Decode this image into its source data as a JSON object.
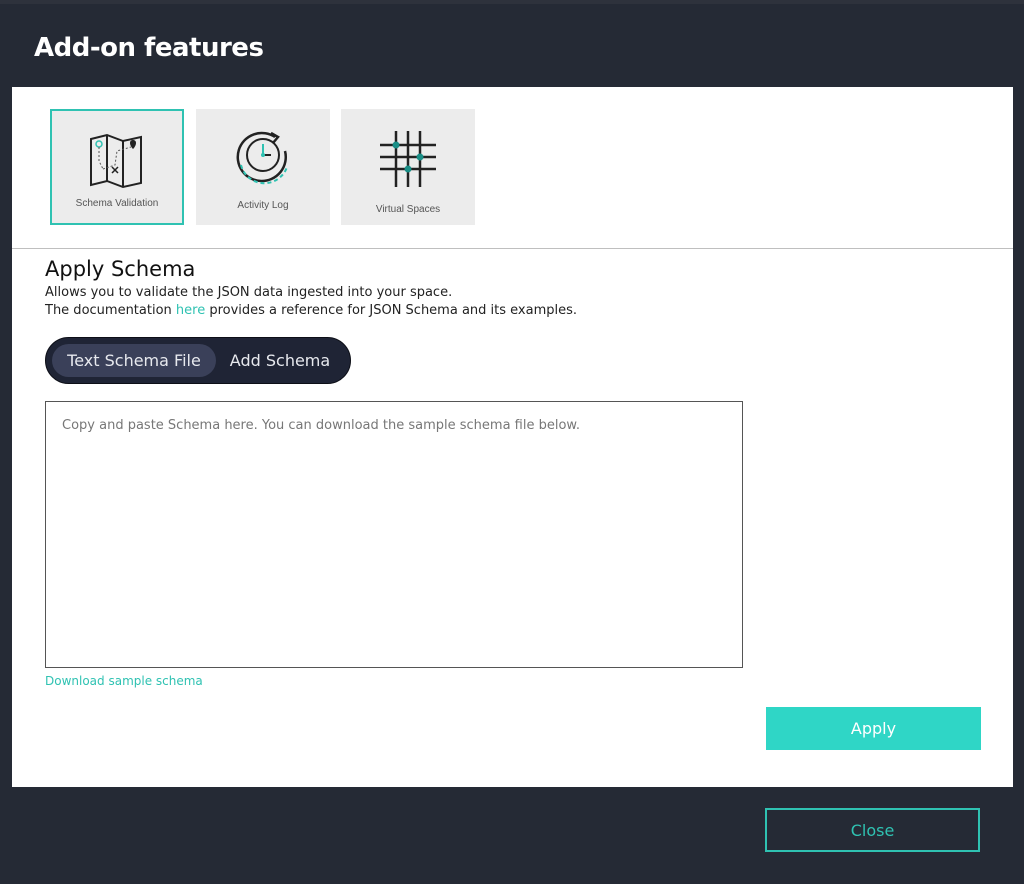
{
  "dialog": {
    "title": "Add-on features"
  },
  "tiles": [
    {
      "label": "Schema Validation",
      "icon": "map-icon",
      "selected": true
    },
    {
      "label": "Activity Log",
      "icon": "clock-icon",
      "selected": false
    },
    {
      "label": "Virtual Spaces",
      "icon": "grid-icon",
      "selected": false
    }
  ],
  "section": {
    "title": "Apply Schema",
    "line1": "Allows you to validate the JSON data ingested into your space.",
    "line2_before": "The documentation ",
    "line2_link": "here",
    "line2_after": " provides a reference for JSON Schema and its examples."
  },
  "toggle": {
    "option1": "Text Schema File",
    "option2": "Add Schema",
    "active": "Text Schema File"
  },
  "schema_input": {
    "placeholder": "Copy and paste Schema here. You can download the sample schema file below.",
    "value": ""
  },
  "download_link": "Download sample schema",
  "buttons": {
    "apply": "Apply",
    "close": "Close"
  },
  "colors": {
    "accent": "#2fc2b2",
    "apply_bg": "#2fd6c6",
    "dialog_bg": "#252a35",
    "toggle_bg": "#1f2435"
  }
}
